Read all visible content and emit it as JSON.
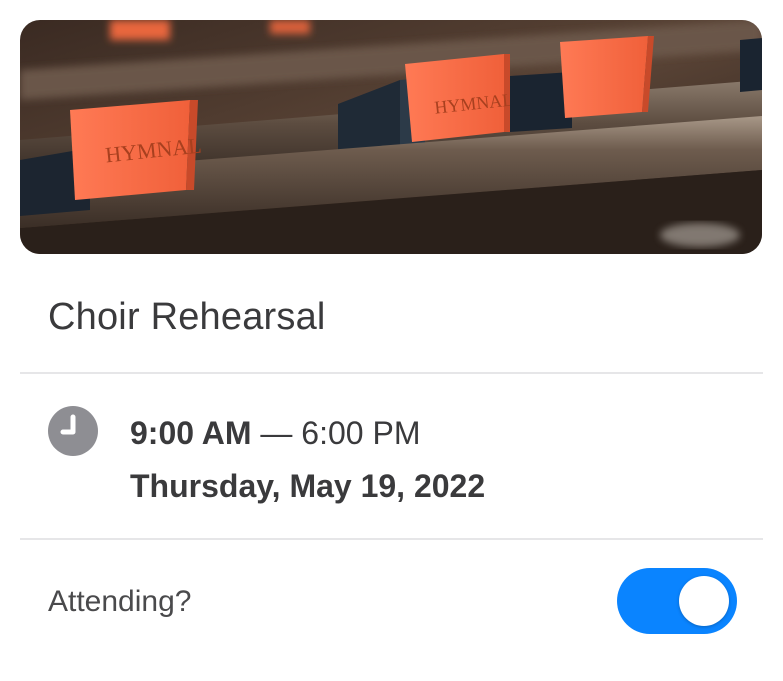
{
  "event": {
    "title": "Choir Rehearsal",
    "start_time": "9:00 AM",
    "separator": " — ",
    "end_time": "6:00 PM",
    "date": "Thursday, May 19, 2022",
    "hero_image_label": "HYMNAL"
  },
  "attending": {
    "label": "Attending?",
    "value": true
  },
  "colors": {
    "accent": "#0a84ff",
    "text": "#3a3a3c",
    "clock_icon": "#8e8e93",
    "divider": "#e6e6e8"
  },
  "icons": {
    "time": "clock-icon"
  }
}
